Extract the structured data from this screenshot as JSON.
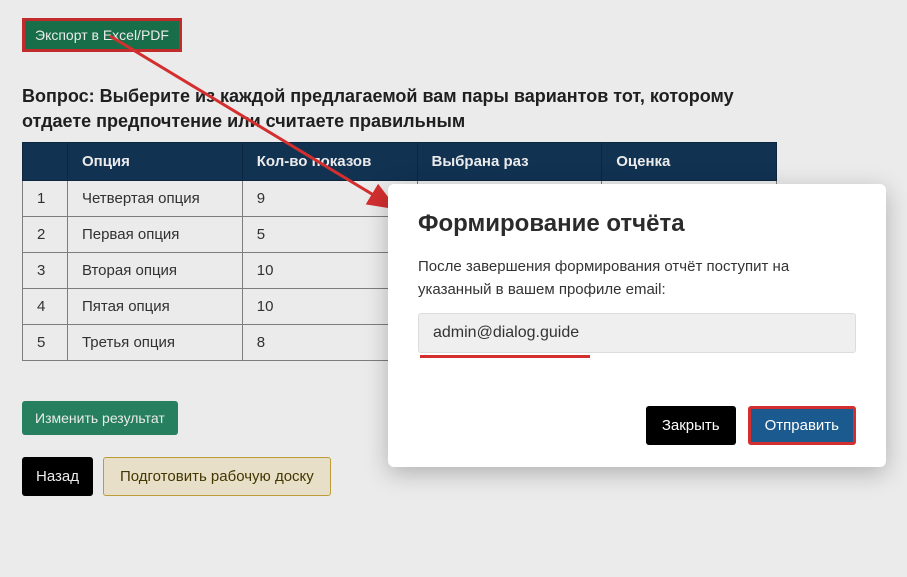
{
  "toolbar": {
    "export_label": "Экспорт в Excel/PDF"
  },
  "question": "Вопрос: Выберите из каждой предлагаемой вам пары вариантов тот, которому отдаете предпочтение или считаете правильным",
  "table": {
    "headers": {
      "idx": "",
      "option": "Опция",
      "shows": "Кол-во показов",
      "chosen": "Выбрана раз",
      "score": "Оценка"
    },
    "rows": [
      {
        "idx": "1",
        "option": "Четвертая опция",
        "shows": "9",
        "chosen": "",
        "score": ""
      },
      {
        "idx": "2",
        "option": "Первая опция",
        "shows": "5",
        "chosen": "",
        "score": ""
      },
      {
        "idx": "3",
        "option": "Вторая опция",
        "shows": "10",
        "chosen": "",
        "score": ""
      },
      {
        "idx": "4",
        "option": "Пятая опция",
        "shows": "10",
        "chosen": "",
        "score": ""
      },
      {
        "idx": "5",
        "option": "Третья опция",
        "shows": "8",
        "chosen": "",
        "score": ""
      }
    ]
  },
  "buttons": {
    "change_result": "Изменить результат",
    "back": "Назад",
    "prepare_board": "Подготовить рабочую доску"
  },
  "modal": {
    "title": "Формирование отчёта",
    "description": "После завершения формирования отчёт поступит на указанный в вашем профиле email:",
    "email_value": "admin@dialog.guide",
    "close_label": "Закрыть",
    "submit_label": "Отправить"
  }
}
